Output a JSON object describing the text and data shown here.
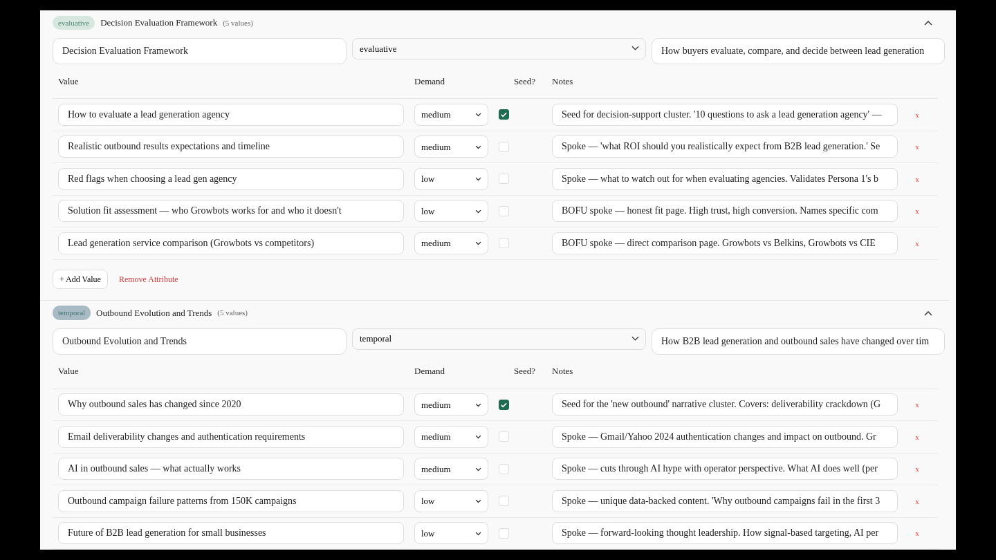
{
  "attributes": [
    {
      "badge": {
        "label": "evaluative",
        "color": "#d5e7de"
      },
      "title": "Decision Evaluation Framework",
      "count": "(5 values)",
      "expanded": true,
      "name": "Decision Evaluation Framework",
      "category": "evaluative",
      "description": "How buyers evaluate, compare, and decide between lead generation",
      "columns": [
        "Value",
        "Demand",
        "Seed?",
        "Notes"
      ],
      "values": [
        {
          "value": "How to evaluate a lead generation agency",
          "demand": "medium",
          "seed": true,
          "notes": "Seed for decision-support cluster. '10 questions to ask a lead generation agency' —",
          "remove": "x"
        },
        {
          "value": "Realistic outbound results expectations and timeline",
          "demand": "medium",
          "seed": false,
          "notes": "Spoke — 'what ROI should you realistically expect from B2B lead generation.' Se",
          "remove": "x"
        },
        {
          "value": "Red flags when choosing a lead gen agency",
          "demand": "low",
          "seed": false,
          "notes": "Spoke — what to watch out for when evaluating agencies. Validates Persona 1's b",
          "remove": "x"
        },
        {
          "value": "Solution fit assessment — who Growbots works for and who it doesn't",
          "demand": "low",
          "seed": false,
          "notes": "BOFU spoke — honest fit page. High trust, high conversion. Names specific com",
          "remove": "x"
        },
        {
          "value": "Lead generation service comparison (Growbots vs competitors)",
          "demand": "medium",
          "seed": false,
          "notes": "BOFU spoke — direct comparison page. Growbots vs Belkins, Growbots vs CIE",
          "remove": "x"
        }
      ],
      "actions": [
        "+ Add Value",
        "Remove Attribute"
      ]
    },
    {
      "badge": {
        "label": "temporal",
        "color": "#a8bbc5"
      },
      "title": "Outbound Evolution and Trends",
      "count": "(5 values)",
      "expanded": true,
      "name": "Outbound Evolution and Trends",
      "category": "temporal",
      "description": "How B2B lead generation and outbound sales have changed over tim",
      "columns": [
        "Value",
        "Demand",
        "Seed?",
        "Notes"
      ],
      "values": [
        {
          "value": "Why outbound sales has changed since 2020",
          "demand": "medium",
          "seed": true,
          "notes": "Seed for the 'new outbound' narrative cluster. Covers: deliverability crackdown (G",
          "remove": "x"
        },
        {
          "value": "Email deliverability changes and authentication requirements",
          "demand": "medium",
          "seed": false,
          "notes": "Spoke — Gmail/Yahoo 2024 authentication changes and impact on outbound. Gr",
          "remove": "x"
        },
        {
          "value": "AI in outbound sales — what actually works",
          "demand": "medium",
          "seed": false,
          "notes": "Spoke — cuts through AI hype with operator perspective. What AI does well (per",
          "remove": "x"
        },
        {
          "value": "Outbound campaign failure patterns from 150K campaigns",
          "demand": "low",
          "seed": false,
          "notes": "Spoke — unique data-backed content. 'Why outbound campaigns fail in the first 3",
          "remove": "x"
        },
        {
          "value": "Future of B2B lead generation for small businesses",
          "demand": "low",
          "seed": false,
          "notes": "Spoke — forward-looking thought leadership. How signal-based targeting, AI per",
          "remove": "x"
        }
      ]
    }
  ]
}
